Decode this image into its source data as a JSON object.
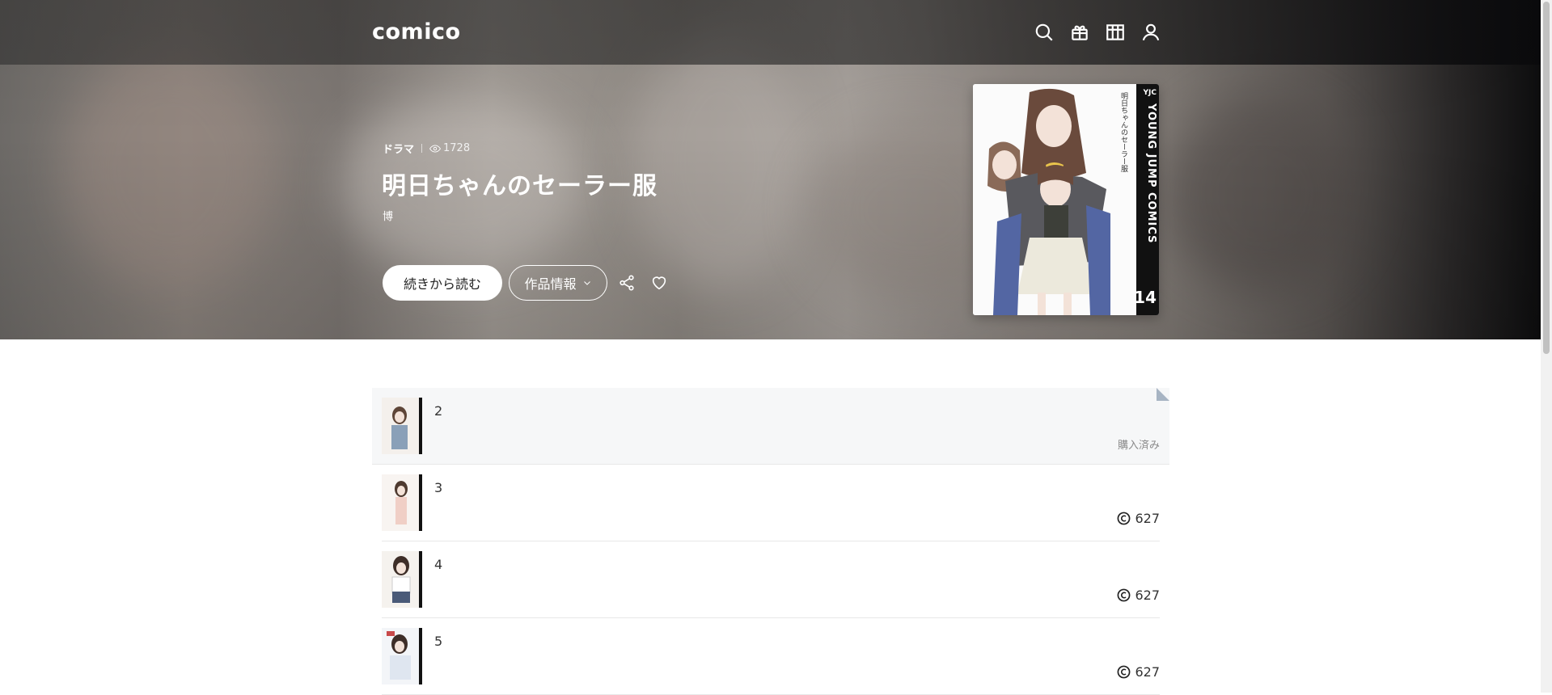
{
  "header": {
    "logo": "comico",
    "icons": [
      "search-icon",
      "gift-icon",
      "bookshelf-icon",
      "account-icon"
    ]
  },
  "work": {
    "genre": "ドラマ",
    "views": "1728",
    "title": "明日ちゃんのセーラー服",
    "author": "博",
    "read_button": "続きから読む",
    "info_button": "作品情報"
  },
  "cover": {
    "label": "YJC",
    "spine": "YOUNG JUMP COMICS",
    "volume": "14"
  },
  "episodes": [
    {
      "number": "2",
      "status": "購入済み",
      "price": ""
    },
    {
      "number": "3",
      "status": "",
      "price": "627"
    },
    {
      "number": "4",
      "status": "",
      "price": "627"
    },
    {
      "number": "5",
      "status": "",
      "price": "627"
    }
  ],
  "colors": {
    "accent_corner": "#a7b4c3",
    "read_row_bg": "#f6f7f8"
  }
}
